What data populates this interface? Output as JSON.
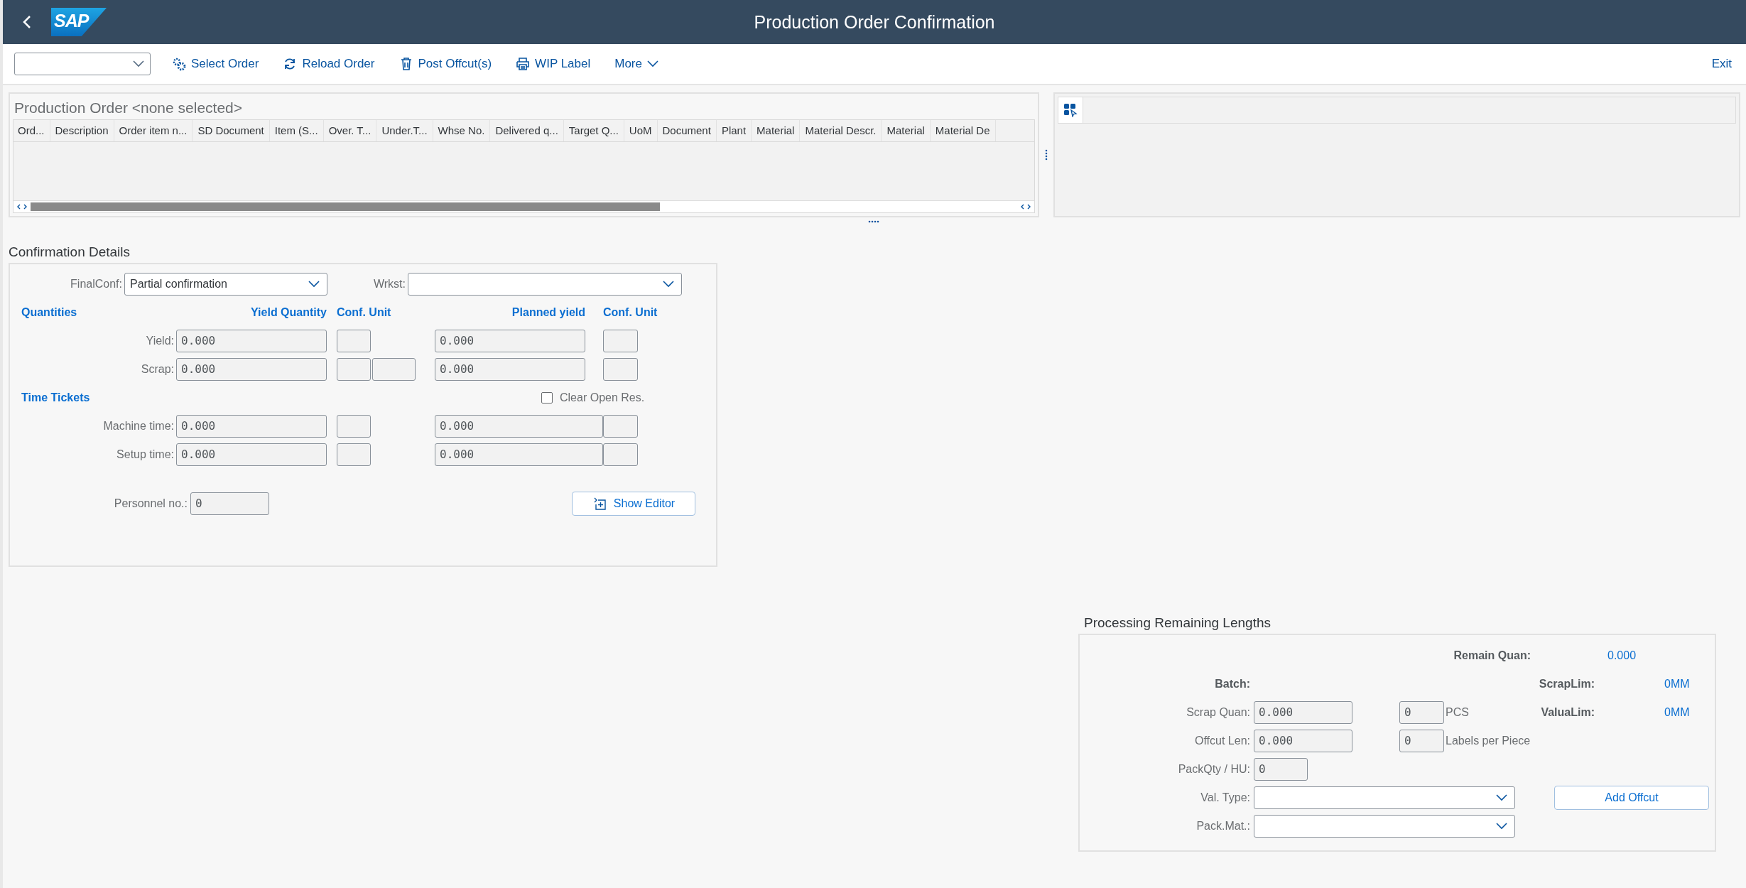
{
  "header": {
    "logo": "SAP",
    "title": "Production Order Confirmation"
  },
  "toolbar": {
    "buttons": [
      {
        "label": "Select Order",
        "kind": "gears"
      },
      {
        "label": "Reload Order",
        "kind": "reload"
      },
      {
        "label": "Post Offcut(s)",
        "kind": "bin"
      },
      {
        "label": "WIP Label",
        "kind": "printer"
      }
    ],
    "more": "More",
    "exit": "Exit"
  },
  "order_table": {
    "title": "Production Order <none selected>",
    "columns": [
      "Ord...",
      "Description",
      "Order item n...",
      "SD Document",
      "Item (S...",
      "Over. T...",
      "Under.T...",
      "Whse No.",
      "Delivered q...",
      "Target Q...",
      "UoM",
      "Document",
      "Plant",
      "Material",
      "Material Descr.",
      "Material",
      "Material De"
    ]
  },
  "confirmation": {
    "title": "Confirmation Details",
    "final_conf": {
      "label": "FinalConf:",
      "value": "Partial confirmation"
    },
    "workstation": {
      "label": "Wrkst:"
    },
    "quantities": {
      "heading": "Quantities",
      "yield_header": "Yield Quantity",
      "unit_header": "Conf. Unit",
      "planned_header": "Planned yield",
      "planned_unit_header": "Conf. Unit"
    },
    "quantity_rows": [
      {
        "label": "Yield:",
        "value": "0.000",
        "planned": "0.000",
        "extra_unit": false
      },
      {
        "label": "Scrap:",
        "value": "0.000",
        "planned": "0.000",
        "extra_unit": true
      }
    ],
    "time_heading": "Time Tickets",
    "clear_open_res": {
      "label": "Clear Open Res.",
      "checked": false
    },
    "time_rows": [
      {
        "label": "Machine time:",
        "value": "0.000",
        "planned": "0.000"
      },
      {
        "label": "Setup time:",
        "value": "0.000",
        "planned": "0.000"
      }
    ],
    "personnel": {
      "label": "Personnel no.:",
      "value": "0"
    },
    "show_editor": "Show Editor"
  },
  "remaining": {
    "title": "Processing Remaining Lengths",
    "remain_quan": {
      "label": "Remain Quan:",
      "value": "0.000"
    },
    "batch": {
      "label": "Batch:"
    },
    "scrap_lim": {
      "label": "ScrapLim:",
      "value": "0MM"
    },
    "value_lim": {
      "label": "ValuaLim:",
      "value": "0MM"
    },
    "scrap_quan": {
      "label": "Scrap Quan:",
      "value": "0.000",
      "count": "0",
      "unit": "PCS"
    },
    "offcut_len": {
      "label": "Offcut Len:",
      "value": "0.000",
      "count": "0",
      "unit": "Labels per Piece"
    },
    "pack_qty": {
      "label": "PackQty / HU:",
      "value": "0"
    },
    "val_type": {
      "label": "Val. Type:"
    },
    "pack_mat": {
      "label": "Pack.Mat.:"
    },
    "add_offcut": "Add Offcut"
  }
}
